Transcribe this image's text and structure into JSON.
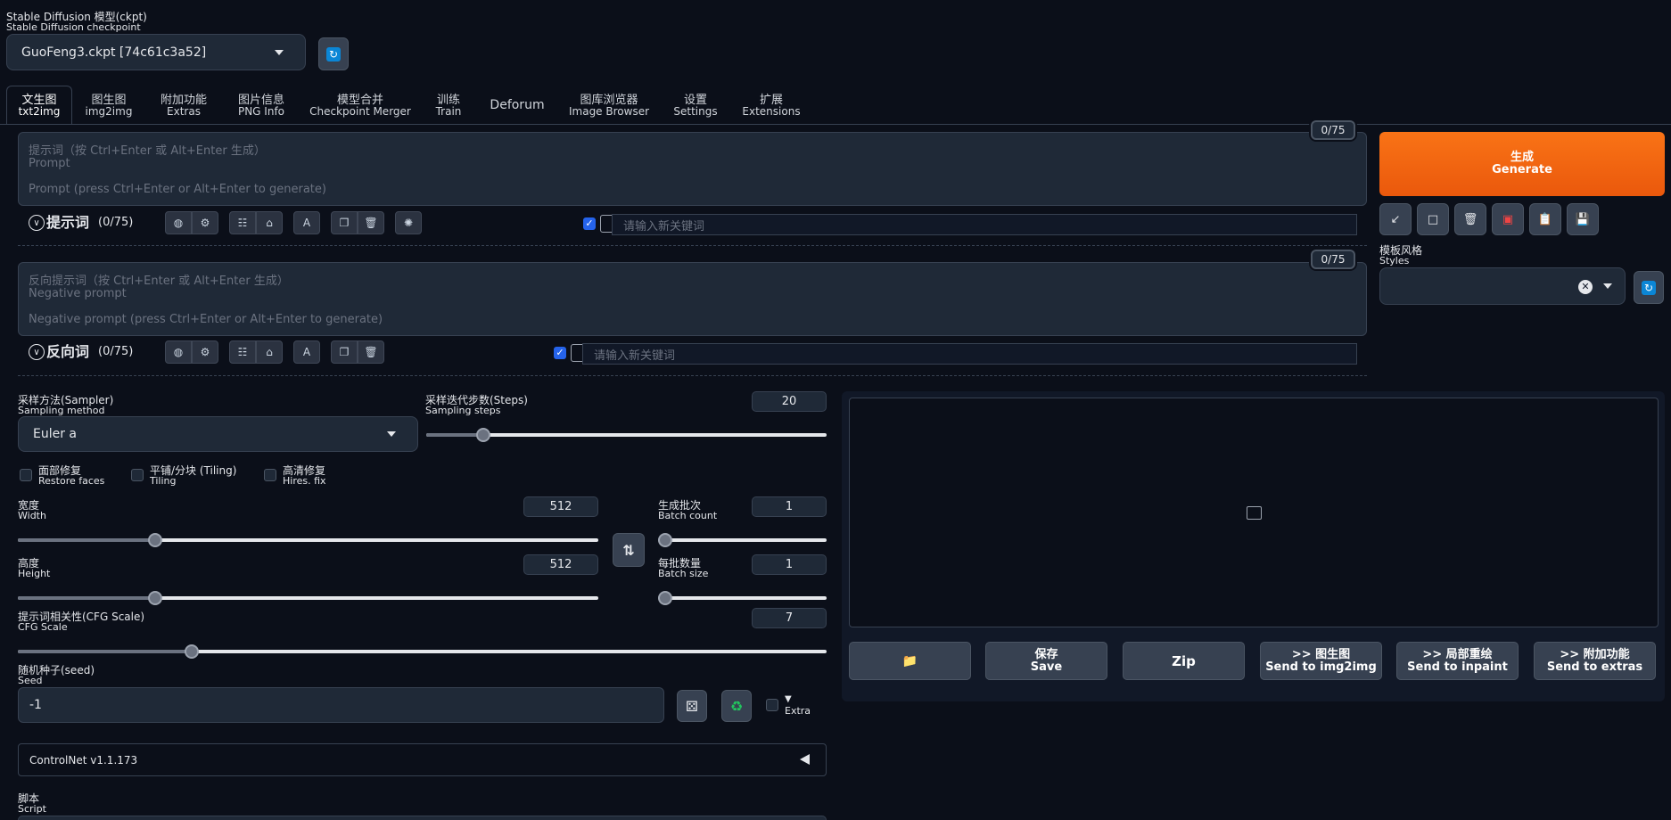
{
  "checkpoint": {
    "label_cn": "Stable Diffusion 模型(ckpt)",
    "label_en": "Stable Diffusion checkpoint",
    "value": "GuoFeng3.ckpt [74c61c3a52]"
  },
  "tabs": [
    {
      "cn": "文生图",
      "en": "txt2img"
    },
    {
      "cn": "图生图",
      "en": "img2img"
    },
    {
      "cn": "附加功能",
      "en": "Extras"
    },
    {
      "cn": "图片信息",
      "en": "PNG Info"
    },
    {
      "cn": "模型合并",
      "en": "Checkpoint Merger"
    },
    {
      "cn": "训练",
      "en": "Train"
    },
    {
      "cn": "Deforum",
      "en": ""
    },
    {
      "cn": "图库浏览器",
      "en": "Image Browser"
    },
    {
      "cn": "设置",
      "en": "Settings"
    },
    {
      "cn": "扩展",
      "en": "Extensions"
    }
  ],
  "prompt": {
    "placeholder_cn": "提示词（按 Ctrl+Enter 或 Alt+Enter 生成）",
    "placeholder_en": "Prompt",
    "placeholder_hint": "Prompt (press Ctrl+Enter or Alt+Enter to generate)",
    "counter": "0/75",
    "toolbar_title": "提示词",
    "toolbar_count": "(0/75)",
    "keyword_placeholder": "请输入新关键词"
  },
  "negative": {
    "placeholder_cn": "反向提示词（按 Ctrl+Enter 或 Alt+Enter 生成）",
    "placeholder_en": "Negative prompt",
    "placeholder_hint": "Negative prompt (press Ctrl+Enter or Alt+Enter to generate)",
    "counter": "0/75",
    "toolbar_title": "反向词",
    "toolbar_count": "(0/75)",
    "keyword_placeholder": "请输入新关键词"
  },
  "generate": {
    "cn": "生成",
    "en": "Generate"
  },
  "styles": {
    "label_cn": "模板风格",
    "label_en": "Styles"
  },
  "sampler": {
    "label_cn": "采样方法(Sampler)",
    "label_en": "Sampling method",
    "value": "Euler a"
  },
  "steps": {
    "label_cn": "采样迭代步数(Steps)",
    "label_en": "Sampling steps",
    "value": "20",
    "fraction": 0.13
  },
  "checkboxes": [
    {
      "cn": "面部修复",
      "en": "Restore faces"
    },
    {
      "cn": "平铺/分块 (Tiling)",
      "en": "Tiling"
    },
    {
      "cn": "高清修复",
      "en": "Hires. fix"
    }
  ],
  "width": {
    "label_cn": "宽度",
    "label_en": "Width",
    "value": "512",
    "fraction": 0.23
  },
  "height": {
    "label_cn": "高度",
    "label_en": "Height",
    "value": "512",
    "fraction": 0.23
  },
  "batch_count": {
    "label_cn": "生成批次",
    "label_en": "Batch count",
    "value": "1",
    "fraction": 0.0
  },
  "batch_size": {
    "label_cn": "每批数量",
    "label_en": "Batch size",
    "value": "1",
    "fraction": 0.0
  },
  "cfg": {
    "label_cn": "提示词相关性(CFG Scale)",
    "label_en": "CFG Scale",
    "value": "7",
    "fraction": 0.21
  },
  "seed": {
    "label_cn": "随机种子(seed)",
    "label_en": "Seed",
    "value": "-1",
    "extra": "Extra"
  },
  "controlnet": {
    "label": "ControlNet v1.1.173"
  },
  "script": {
    "label_cn": "脚本",
    "label_en": "Script"
  },
  "output_buttons": [
    {
      "cn": "",
      "en": ""
    },
    {
      "cn": "保存",
      "en": "Save"
    },
    {
      "cn": "Zip",
      "en": ""
    },
    {
      "cn": ">> 图生图",
      "en": "Send to img2img"
    },
    {
      "cn": ">> 局部重绘",
      "en": "Send to inpaint"
    },
    {
      "cn": ">> 附加功能",
      "en": "Send to extras"
    }
  ],
  "colors": {
    "accent": "#f97316",
    "check": "#2563eb",
    "bg": "#0b0f19"
  }
}
